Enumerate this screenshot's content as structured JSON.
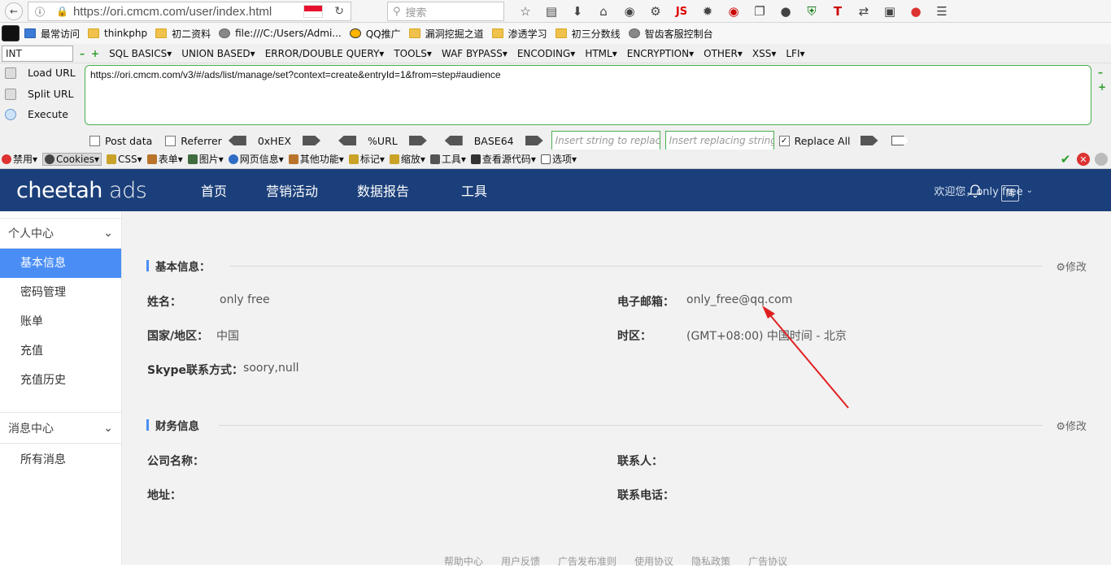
{
  "browser": {
    "url": "https://ori.cmcm.com/user/index.html",
    "search_placeholder": "搜索",
    "bookmarks": [
      "最常访问",
      "thinkphp",
      "初二资料",
      "file:///C:/Users/Admi...",
      "QQ推广",
      "漏洞挖掘之道",
      "渗透学习",
      "初三分数线",
      "智齿客服控制台"
    ]
  },
  "hackbar": {
    "select_value": "INT",
    "menu": [
      "SQL BASICS▾",
      "UNION BASED▾",
      "ERROR/DOUBLE QUERY▾",
      "TOOLS▾",
      "WAF BYPASS▾",
      "ENCODING▾",
      "HTML▾",
      "ENCRYPTION▾",
      "OTHER▾",
      "XSS▾",
      "LFI▾"
    ],
    "load_url": "Load URL",
    "split_url": "Split URL",
    "execute": "Execute",
    "textarea": "https://ori.cmcm.com/v3/#/ads/list/manage/set?context=create&entryId=1&from=step#audience",
    "post_data": "Post data",
    "referrer": "Referrer",
    "hex": "0xHEX",
    "url_enc": "%URL",
    "base64": "BASE64",
    "insert_placeholder": "Insert string to replace",
    "replacing_placeholder": "Insert replacing string",
    "replace_all": "Replace All"
  },
  "webdev": {
    "items": [
      "禁用▾",
      "Cookies▾",
      "CSS▾",
      "表单▾",
      "图片▾",
      "网页信息▾",
      "其他功能▾",
      "标记▾",
      "缩放▾",
      "工具▾",
      "查看源代码▾",
      "选项▾"
    ]
  },
  "site": {
    "logo_main": "cheetah",
    "logo_ads": "ads",
    "nav": [
      "首页",
      "营销活动",
      "数据报告",
      "工具"
    ],
    "welcome": "欢迎您，only free",
    "lang": "简"
  },
  "sidebar": {
    "group1": "个人中心",
    "items1": [
      "基本信息",
      "密码管理",
      "账单",
      "充值",
      "充值历史"
    ],
    "group2": "消息中心",
    "items2": [
      "所有消息"
    ]
  },
  "basic": {
    "title": "基本信息：",
    "edit": "修改",
    "name_label": "姓名：",
    "name_value": "only free",
    "email_label": "电子邮箱：",
    "email_value": "only_free@qq.com",
    "country_label": "国家/地区：",
    "country_value": "中国",
    "tz_label": "时区：",
    "tz_value": "(GMT+08:00) 中国时间 - 北京",
    "skype_label": "Skype联系方式：",
    "skype_value": "soory,null"
  },
  "finance": {
    "title": "财务信息",
    "edit": "修改",
    "company_label": "公司名称：",
    "contact_label": "联系人：",
    "address_label": "地址：",
    "phone_label": "联系电话："
  },
  "footer": [
    "帮助中心",
    "用户反馈",
    "广告发布准则",
    "使用协议",
    "隐私政策",
    "广告协议"
  ]
}
